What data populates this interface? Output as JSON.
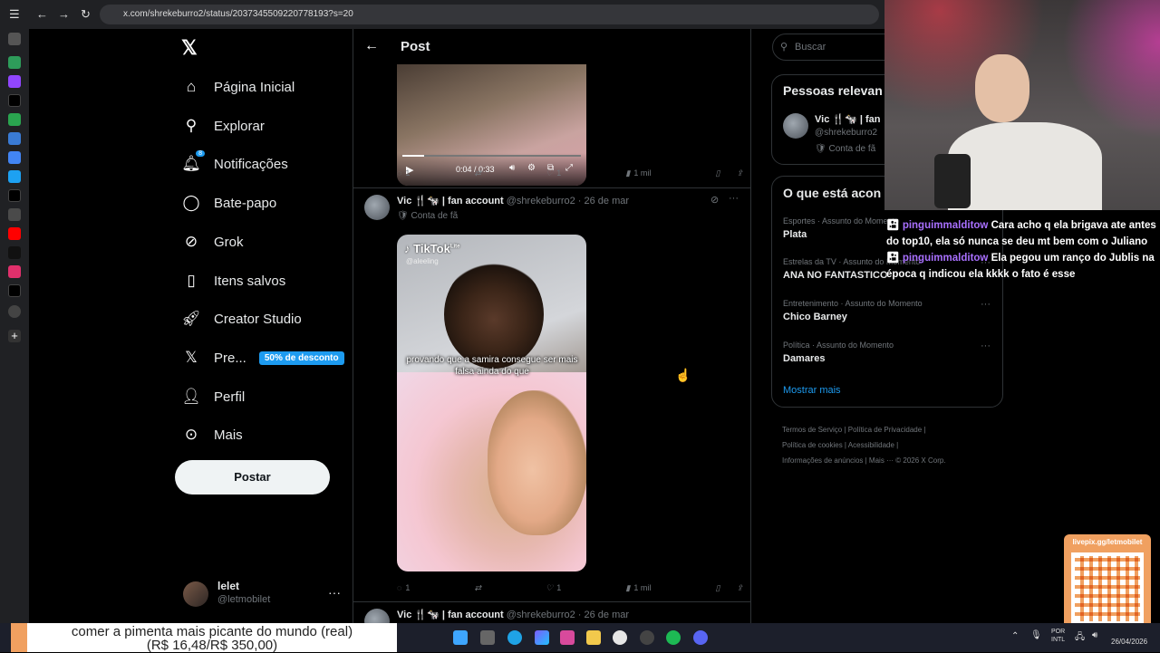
{
  "browser": {
    "url": "x.com/shrekeburro2/status/2037345509220778193?s=20"
  },
  "nav": {
    "items": [
      {
        "label": "Página Inicial",
        "icon": "home-icon"
      },
      {
        "label": "Explorar",
        "icon": "search-icon"
      },
      {
        "label": "Notificações",
        "icon": "bell-icon",
        "badge": "8"
      },
      {
        "label": "Bate-papo",
        "icon": "chat-icon"
      },
      {
        "label": "Grok",
        "icon": "grok-icon"
      },
      {
        "label": "Itens salvos",
        "icon": "bookmark-icon"
      },
      {
        "label": "Creator Studio",
        "icon": "rocket-icon"
      },
      {
        "label": "Pre...",
        "icon": "x-logo-icon",
        "promo": "50% de desconto"
      },
      {
        "label": "Perfil",
        "icon": "person-icon"
      },
      {
        "label": "Mais",
        "icon": "more-circle-icon"
      }
    ],
    "post_button": "Postar",
    "profile": {
      "name": "lelet",
      "handle": "@letmobilet"
    }
  },
  "header": {
    "title": "Post"
  },
  "video1": {
    "time": "0:04 / 0:33"
  },
  "tweet1_actions": {
    "replies": "1",
    "likes": "1",
    "views": "1 mil"
  },
  "tweet2": {
    "name": "Vic 🍴🐄 | fan account",
    "handle": "@shrekeburro2",
    "date": "· 26 de mar",
    "label": "Conta de fã",
    "tiktok": "TikTok",
    "tiktok_lite": "Lite",
    "tiktok_user": "@aleeling",
    "caption": "provando que a samira consegue ser mais falsa ainda do que",
    "replies": "1",
    "likes": "1",
    "views": "1 mil"
  },
  "tweet3": {
    "name": "Vic 🍴🐄 | fan account",
    "handle": "@shrekeburro2",
    "date": "· 26 de mar"
  },
  "right": {
    "search_placeholder": "Buscar",
    "people_title": "Pessoas relevan",
    "person": {
      "name": "Vic 🍴🐄 | fan",
      "handle": "@shrekeburro2",
      "label": "Conta de fã"
    },
    "trends_title": "O que está acon",
    "trends": [
      {
        "cat": "Esportes · Assunto do Momento",
        "name": "Plata"
      },
      {
        "cat": "Estrelas da TV · Assunto do Momento",
        "name": "ANA NO FANTASTICO"
      },
      {
        "cat": "Entretenimento · Assunto do Momento",
        "name": "Chico Barney"
      },
      {
        "cat": "Política · Assunto do Momento",
        "name": "Damares"
      }
    ],
    "show_more": "Mostrar mais",
    "footer": [
      "Termos de Serviço",
      "Política de Privacidade",
      "Política de cookies",
      "Acessibilidade",
      "Informações de anúncios",
      "Mais ···",
      "© 2026 X Corp."
    ]
  },
  "chat": [
    {
      "user": "pinguimmalditow",
      "msg": "Cara acho q ela brigava ate antes do top10, ela só nunca se deu mt bem com o Juliano"
    },
    {
      "user": "pinguimmalditow",
      "msg": "Ela pegou um ranço do Jublis na época q indicou ela kkkk o fato é esse"
    }
  ],
  "overlay": {
    "livepix": "livepix.gg/letmobilet",
    "ticker_line1": "comer a pimenta mais picante do mundo (real)",
    "ticker_line2": "(R$ 16,48/R$ 350,00)"
  },
  "taskbar": {
    "lang1": "POR",
    "lang2": "INTL",
    "date": "26/04/2026"
  },
  "colors": {
    "accent": "#1d9bf0",
    "chat_user": "#a970ff",
    "background": "#000000"
  }
}
